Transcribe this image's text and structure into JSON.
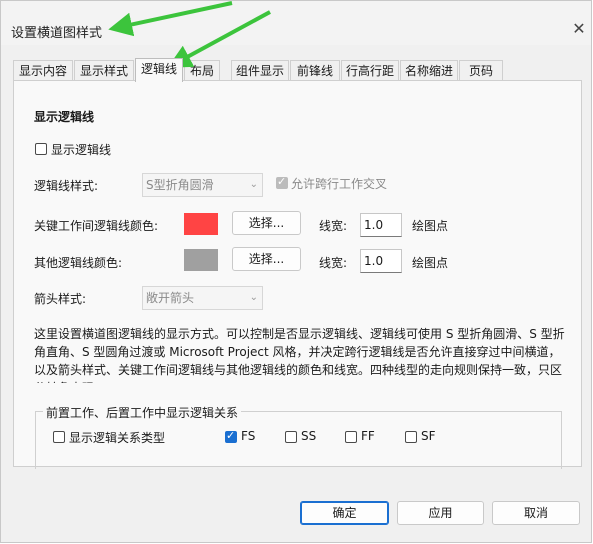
{
  "window": {
    "title": "设置横道图样式"
  },
  "tabs": [
    {
      "label": "显示内容"
    },
    {
      "label": "显示样式"
    },
    {
      "label": "逻辑线"
    },
    {
      "label": "布局"
    },
    {
      "label": "组件显示"
    },
    {
      "label": "前锋线"
    },
    {
      "label": "行高行距"
    },
    {
      "label": "名称缩进"
    },
    {
      "label": "页码"
    }
  ],
  "panel": {
    "heading": "显示逻辑线",
    "show_logic_line": {
      "label": "显示逻辑线",
      "checked": false
    },
    "line_style": {
      "label": "逻辑线样式:",
      "value": "S型折角圆滑"
    },
    "allow_cross": {
      "label": "允许跨行工作交叉",
      "checked": true
    },
    "critical_color": {
      "label": "关键工作间逻辑线颜色:",
      "color": "#ff4444",
      "button": "选择...",
      "width_label": "线宽:",
      "width_value": "1.0",
      "unit": "绘图点"
    },
    "other_color": {
      "label": "其他逻辑线颜色:",
      "color": "#a0a0a0",
      "button": "选择...",
      "width_label": "线宽:",
      "width_value": "1.0",
      "unit": "绘图点"
    },
    "arrow_style": {
      "label": "箭头样式:",
      "value": "敞开箭头"
    },
    "description": "这里设置横道图逻辑线的显示方式。可以控制是否显示逻辑线、逻辑线可使用 S 型折角圆滑、S 型折角直角、S 型圆角过渡或 Microsoft Project 风格，并决定跨行逻辑线是否允许直接穿过中间横道，以及箭头样式、关键工作间逻辑线与其他逻辑线的颜色和线宽。四种线型的走向规则保持一致，只区分转角表现。",
    "group": {
      "title": "前置工作、后置工作中显示逻辑关系",
      "show_type": {
        "label": "显示逻辑关系类型",
        "checked": false
      },
      "fs": {
        "label": "FS",
        "checked": true
      },
      "ss": {
        "label": "SS",
        "checked": false
      },
      "ff": {
        "label": "FF",
        "checked": false
      },
      "sf": {
        "label": "SF",
        "checked": false
      }
    }
  },
  "footer": {
    "ok": "确定",
    "apply": "应用",
    "cancel": "取消"
  },
  "colors": {
    "accent": "#1a6fd1",
    "annotation": "#3cc43c"
  }
}
